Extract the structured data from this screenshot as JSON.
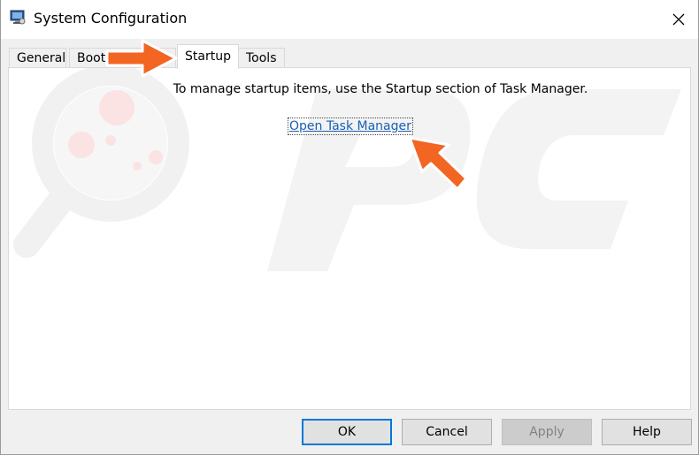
{
  "window": {
    "title": "System Configuration"
  },
  "tabs": [
    {
      "label": "General",
      "active": false
    },
    {
      "label": "Boot",
      "active": false
    },
    {
      "label": "Startup",
      "active": true
    },
    {
      "label": "Tools",
      "active": false
    }
  ],
  "panel": {
    "info_text": "To manage startup items, use the Startup section of Task Manager.",
    "link_label": "Open Task Manager"
  },
  "buttons": {
    "ok": "OK",
    "cancel": "Cancel",
    "apply": "Apply",
    "help": "Help"
  },
  "colors": {
    "annotation_arrow": "#f26522",
    "link": "#1a5fb4",
    "default_button_border": "#0078d7"
  },
  "icons": {
    "app": "system-configuration-icon",
    "close": "close-icon",
    "annotation": "arrow-icon"
  }
}
